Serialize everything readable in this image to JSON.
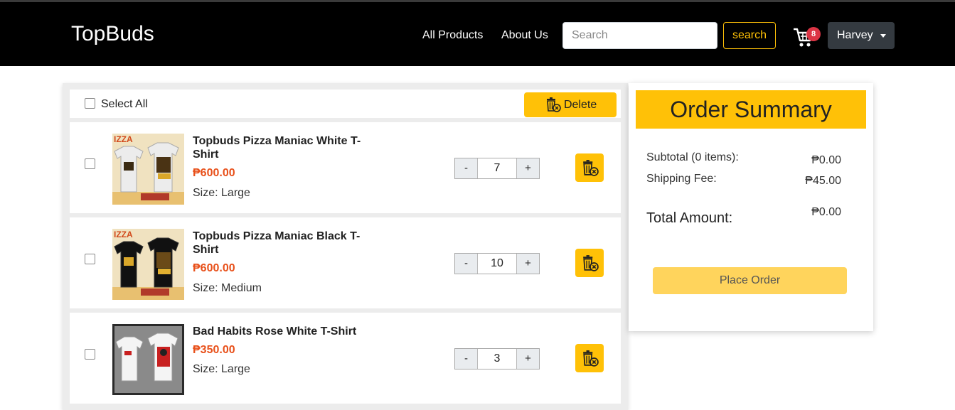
{
  "navbar": {
    "brand": "TopBuds",
    "links": [
      "All Products",
      "About Us"
    ],
    "search_placeholder": "Search",
    "search_button": "search",
    "cart_count": "8",
    "user": "Harvey"
  },
  "cart": {
    "select_all_label": "Select All",
    "delete_label": "Delete",
    "items": [
      {
        "name": "Topbuds Pizza Maniac White T-Shirt",
        "price": "₱600.00",
        "size": "Size: Large",
        "quantity": "7",
        "shirt_color": "#f0f0f0"
      },
      {
        "name": "Topbuds Pizza Maniac Black T-Shirt",
        "price": "₱600.00",
        "size": "Size: Medium",
        "quantity": "10",
        "shirt_color": "#111111"
      },
      {
        "name": "Bad Habits Rose White T-Shirt",
        "price": "₱350.00",
        "size": "Size: Large",
        "quantity": "3",
        "shirt_color": "#f4f4f4"
      }
    ],
    "minus": "-",
    "plus": "+"
  },
  "summary": {
    "title": "Order Summary",
    "subtotal_label": "Subtotal (0 items):",
    "subtotal_value": "₱0.00",
    "shipping_label": "Shipping Fee:",
    "shipping_value": "₱45.00",
    "total_label": "Total Amount:",
    "total_value": "₱0.00",
    "place_order": "Place Order"
  },
  "colors": {
    "accent": "#ffc107",
    "price": "#e8501a",
    "badge": "#dc3545"
  }
}
